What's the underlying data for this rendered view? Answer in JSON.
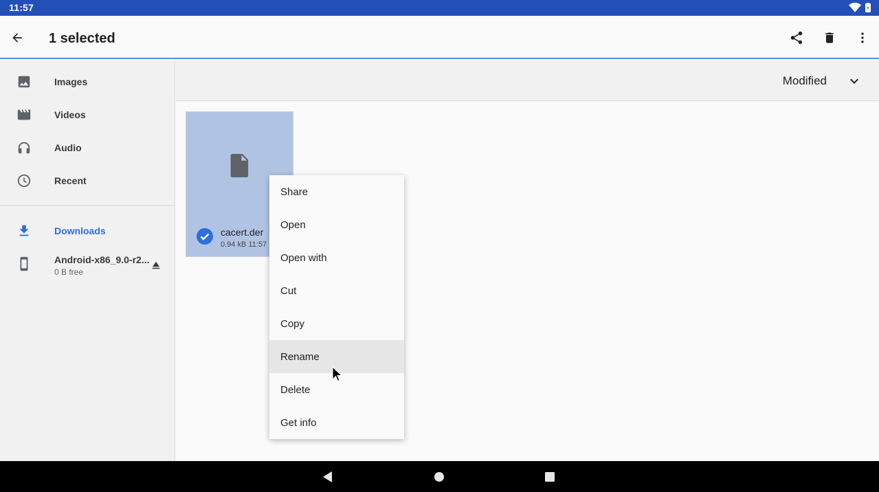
{
  "status_bar": {
    "time": "11:57",
    "wifi_icon": "wifi-icon",
    "battery_icon": "battery-icon"
  },
  "app_bar": {
    "title": "1 selected",
    "back_icon": "arrow-back-icon",
    "share_icon": "share-icon",
    "delete_icon": "trash-icon",
    "more_icon": "more-vert-icon"
  },
  "sidebar": {
    "items": [
      {
        "label": "Images",
        "icon": "image-icon"
      },
      {
        "label": "Videos",
        "icon": "film-icon"
      },
      {
        "label": "Audio",
        "icon": "headphones-icon"
      },
      {
        "label": "Recent",
        "icon": "clock-icon"
      }
    ],
    "downloads": {
      "label": "Downloads",
      "icon": "download-icon"
    },
    "storage": {
      "label": "Android-x86_9.0-r2...",
      "sub": "0 B free",
      "icon": "phone-icon",
      "eject_icon": "eject-icon"
    }
  },
  "sort": {
    "label": "Modified"
  },
  "file": {
    "name": "cacert.der",
    "meta": "0.94 kB 11:57"
  },
  "context_menu": {
    "items": [
      "Share",
      "Open",
      "Open with",
      "Cut",
      "Copy",
      "Rename",
      "Delete",
      "Get info"
    ],
    "highlighted": "Rename"
  },
  "colors": {
    "status_bar": "#2350b8",
    "accent": "#2f6fdb",
    "selection": "#b1c3e3"
  }
}
